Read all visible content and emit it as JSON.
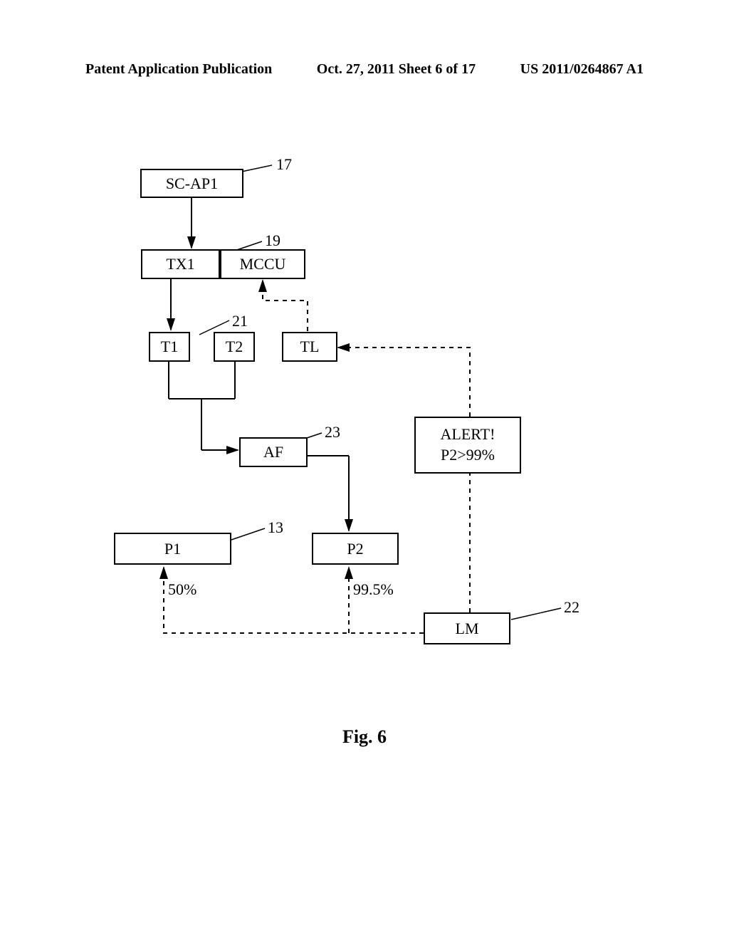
{
  "header": {
    "left": "Patent Application Publication",
    "center": "Oct. 27, 2011   Sheet 6 of 17",
    "right": "US 2011/0264867 A1"
  },
  "boxes": {
    "scap1": "SC-AP1",
    "tx1": "TX1",
    "mccu": "MCCU",
    "t1": "T1",
    "t2": "T2",
    "tl": "TL",
    "af": "AF",
    "p1": "P1",
    "p2": "P2",
    "lm": "LM",
    "alert_line1": "ALERT!",
    "alert_line2": "P2>99%"
  },
  "refnums": {
    "r17": "17",
    "r19": "19",
    "r21": "21",
    "r23": "23",
    "r13": "13",
    "r22": "22"
  },
  "pct": {
    "p1": "50%",
    "p2": "99.5%"
  },
  "figure": "Fig. 6"
}
